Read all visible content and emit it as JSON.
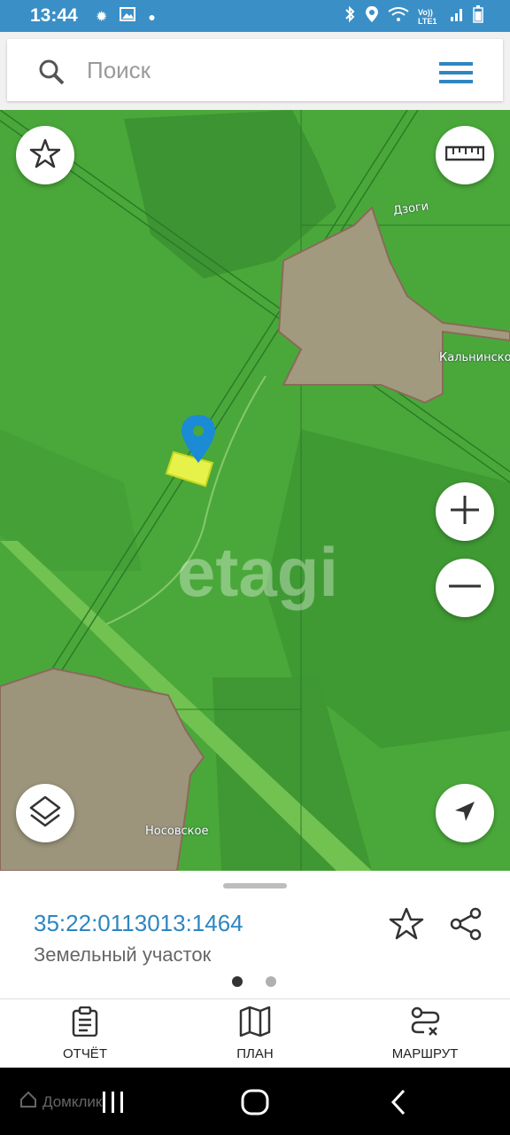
{
  "status": {
    "time": "13:44",
    "network": "Vo)) LTE1"
  },
  "search": {
    "placeholder": "Поиск"
  },
  "map": {
    "labels": {
      "top_right": "Дзоги",
      "right": "Кальнинское",
      "bottom": "Носовское"
    },
    "watermark": "etagi"
  },
  "parcel": {
    "cadastral_number": "35:22:0113013:1464",
    "type": "Земельный участок"
  },
  "pager": {
    "active_index": 0,
    "count": 2
  },
  "nav": {
    "report": "ОТЧЁТ",
    "plan": "ПЛАН",
    "route": "МАРШРУТ"
  },
  "system": {
    "brand": "Домклик"
  },
  "colors": {
    "accent": "#2e86c1",
    "map_green": "#4aa83a",
    "parcel": "#e6f24a",
    "pin": "#1a8bd4"
  }
}
